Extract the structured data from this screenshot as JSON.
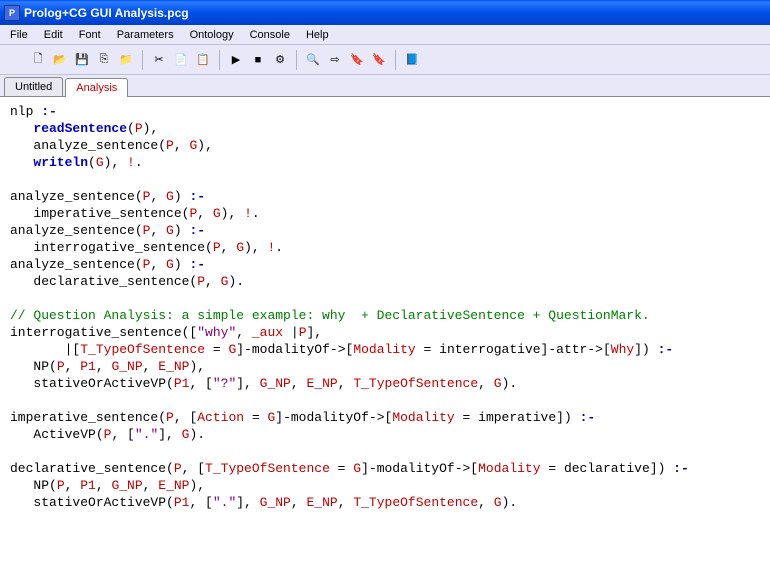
{
  "window": {
    "title": "Prolog+CG GUI Analysis.pcg",
    "icon_label": "P"
  },
  "menu": {
    "items": [
      "File",
      "Edit",
      "Font",
      "Parameters",
      "Ontology",
      "Console",
      "Help"
    ]
  },
  "toolbar": {
    "items": [
      {
        "name": "new-icon",
        "glyph": "🗋"
      },
      {
        "name": "open-icon",
        "glyph": "📂"
      },
      {
        "name": "save-icon",
        "glyph": "💾"
      },
      {
        "name": "save-all-icon",
        "glyph": "⎘"
      },
      {
        "name": "close-icon",
        "glyph": "📁"
      },
      {
        "sep": true
      },
      {
        "name": "cut-icon",
        "glyph": "✂"
      },
      {
        "name": "copy-icon",
        "glyph": "📄"
      },
      {
        "name": "paste-icon",
        "glyph": "📋"
      },
      {
        "sep": true
      },
      {
        "name": "run-icon",
        "glyph": "▶"
      },
      {
        "name": "stop-icon",
        "glyph": "■"
      },
      {
        "name": "debug-icon",
        "glyph": "⚙"
      },
      {
        "sep": true
      },
      {
        "name": "find-icon",
        "glyph": "🔍"
      },
      {
        "name": "find-next-icon",
        "glyph": "⇨"
      },
      {
        "name": "bookmark-icon",
        "glyph": "🔖"
      },
      {
        "name": "bookmark2-icon",
        "glyph": "🔖"
      },
      {
        "sep": true
      },
      {
        "name": "help-icon",
        "glyph": "📘"
      }
    ]
  },
  "tabs": {
    "items": [
      {
        "label": "Untitled",
        "active": false
      },
      {
        "label": "Analysis",
        "active": true
      }
    ]
  },
  "code": {
    "l01a": "nlp ",
    "l01b": ":-",
    "l02a": "   ",
    "l02b": "readSentence",
    "l02c": "(",
    "l02d": "P",
    "l02e": "),",
    "l03a": "   analyze_sentence(",
    "l03b": "P",
    "l03c": ", ",
    "l03d": "G",
    "l03e": "),",
    "l04a": "   ",
    "l04b": "writeln",
    "l04c": "(",
    "l04d": "G",
    "l04e": "), ",
    "l04f": "!",
    "l04g": ".",
    "l06a": "analyze_sentence(",
    "l06b": "P",
    "l06c": ", ",
    "l06d": "G",
    "l06e": ") ",
    "l06f": ":-",
    "l07a": "   imperative_sentence(",
    "l07b": "P",
    "l07c": ", ",
    "l07d": "G",
    "l07e": "), ",
    "l07f": "!",
    "l07g": ".",
    "l08a": "analyze_sentence(",
    "l08b": "P",
    "l08c": ", ",
    "l08d": "G",
    "l08e": ") ",
    "l08f": ":-",
    "l09a": "   interrogative_sentence(",
    "l09b": "P",
    "l09c": ", ",
    "l09d": "G",
    "l09e": "), ",
    "l09f": "!",
    "l09g": ".",
    "l10a": "analyze_sentence(",
    "l10b": "P",
    "l10c": ", ",
    "l10d": "G",
    "l10e": ") ",
    "l10f": ":-",
    "l11a": "   declarative_sentence(",
    "l11b": "P",
    "l11c": ", ",
    "l11d": "G",
    "l11e": ").",
    "l13": "// Question Analysis: a simple example: why  + DeclarativeSentence + QuestionMark.",
    "l14a": "interrogative_sentence([",
    "l14b": "\"why\"",
    "l14c": ", ",
    "l14d": "_aux",
    "l14e": " |",
    "l14f": "P",
    "l14g": "],",
    "l15a": "       ",
    "l15cur": "|",
    "l15b": "[",
    "l15c": "T_TypeOfSentence",
    "l15d": " = ",
    "l15e": "G",
    "l15f": "]-modalityOf->[",
    "l15g": "Modality",
    "l15h": " = interrogative]-attr->[",
    "l15i": "Why",
    "l15j": "]) ",
    "l15k": ":-",
    "l16a": "   NP(",
    "l16b": "P",
    "l16c": ", ",
    "l16d": "P1",
    "l16e": ", ",
    "l16f": "G_NP",
    "l16g": ", ",
    "l16h": "E_NP",
    "l16i": "),",
    "l17a": "   stativeOrActiveVP(",
    "l17b": "P1",
    "l17c": ", [",
    "l17d": "\"?\"",
    "l17e": "], ",
    "l17f": "G_NP",
    "l17g": ", ",
    "l17h": "E_NP",
    "l17i": ", ",
    "l17j": "T_TypeOfSentence",
    "l17k": ", ",
    "l17l": "G",
    "l17m": ").",
    "l19a": "imperative_sentence(",
    "l19b": "P",
    "l19c": ", [",
    "l19d": "Action",
    "l19e": " = ",
    "l19f": "G",
    "l19g": "]-modalityOf->[",
    "l19h": "Modality",
    "l19i": " = imperative]) ",
    "l19j": ":-",
    "l20a": "   ActiveVP(",
    "l20b": "P",
    "l20c": ", [",
    "l20d": "\".\"",
    "l20e": "], ",
    "l20f": "G",
    "l20g": ").",
    "l22a": "declarative_sentence(",
    "l22b": "P",
    "l22c": ", [",
    "l22d": "T_TypeOfSentence",
    "l22e": " = ",
    "l22f": "G",
    "l22g": "]-modalityOf->[",
    "l22h": "Modality",
    "l22i": " = declarative]) ",
    "l22j": ":-",
    "l23a": "   NP(",
    "l23b": "P",
    "l23c": ", ",
    "l23d": "P1",
    "l23e": ", ",
    "l23f": "G_NP",
    "l23g": ", ",
    "l23h": "E_NP",
    "l23i": "),",
    "l24a": "   stativeOrActiveVP(",
    "l24b": "P1",
    "l24c": ", [",
    "l24d": "\".\"",
    "l24e": "], ",
    "l24f": "G_NP",
    "l24g": ", ",
    "l24h": "E_NP",
    "l24i": ", ",
    "l24j": "T_TypeOfSentence",
    "l24k": ", ",
    "l24l": "G",
    "l24m": ")."
  }
}
